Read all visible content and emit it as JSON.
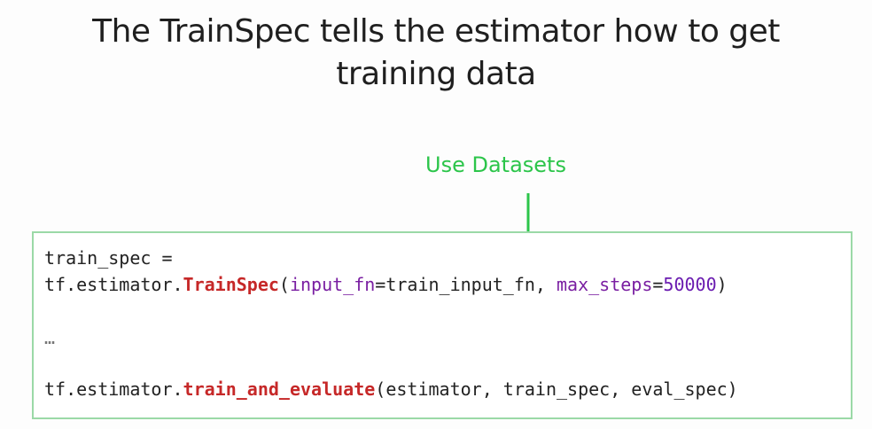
{
  "slide": {
    "title_line1": "The TrainSpec tells the estimator how to get",
    "title_line2": "training data",
    "callout_label": "Use Datasets",
    "callout_color": "#2cc54a",
    "code": {
      "line1": "train_spec =",
      "line2": {
        "prefix": "tf.estimator.",
        "func": "TrainSpec",
        "open": "(",
        "arg1_name": "input_fn",
        "arg1_eq": "=train_input_fn, ",
        "arg2_name": "max_steps",
        "arg2_eq": "=",
        "arg2_value": "50000",
        "close": ")"
      },
      "ellipsis": "…",
      "line4": {
        "prefix": "tf.estimator.",
        "func": "train_and_evaluate",
        "args": "(estimator, train_spec, eval_spec)"
      },
      "colors": {
        "function": "#c62828",
        "keyword_arg": "#7a1fa2",
        "border": "#9bd9a7"
      }
    }
  }
}
